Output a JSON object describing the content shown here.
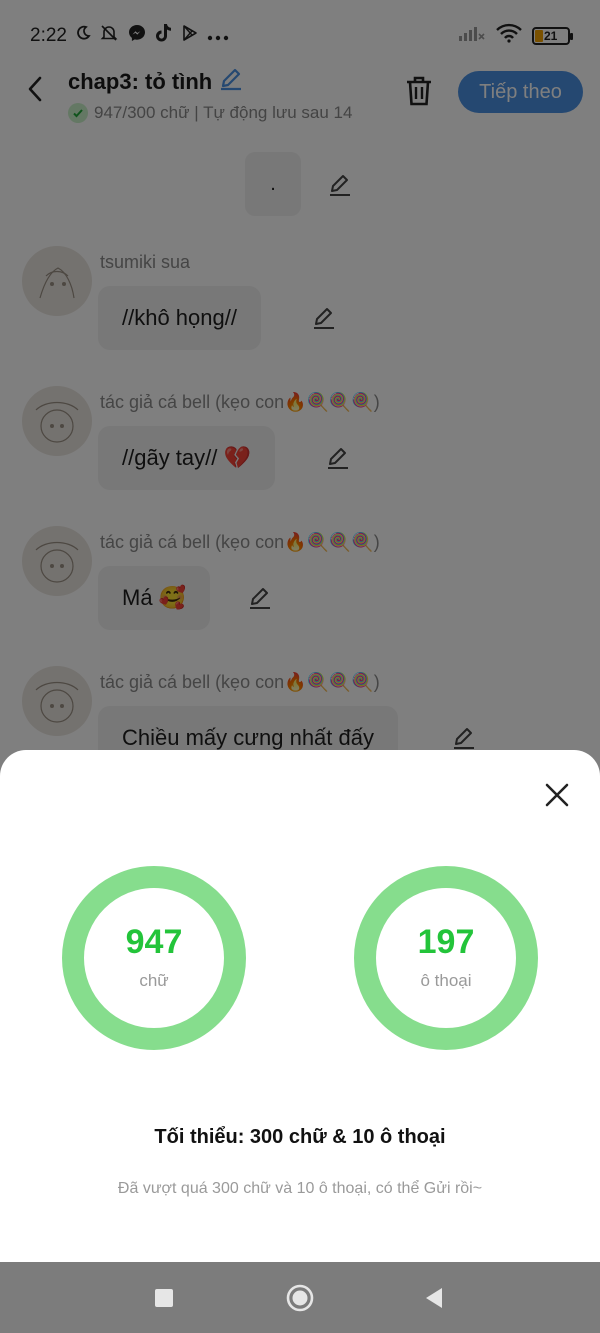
{
  "status_bar": {
    "time": "2:22",
    "battery": "21",
    "left_icons": [
      "moon-icon",
      "muted-bell-icon",
      "messenger-icon",
      "tiktok-icon",
      "play-store-icon",
      "more-dots-icon"
    ],
    "right_icons": [
      "signal-icon",
      "wifi-icon",
      "battery-icon"
    ]
  },
  "header": {
    "title": "chap3: tỏ tình",
    "subtitle": "947/300 chữ | Tự động lưu sau 14",
    "next_label": "Tiếp theo",
    "accent_color": "#4a90e2"
  },
  "chat": {
    "first_bubble": ".",
    "messages": [
      {
        "name": "tsumiki sua",
        "text": "//khô họng//"
      },
      {
        "name": "tác giả cá bell (kẹo con🔥🍭🍭🍭)",
        "text": "//gãy tay// 💔"
      },
      {
        "name": "tác giả cá bell (kẹo con🔥🍭🍭🍭)",
        "text": "Má 🥰"
      },
      {
        "name": "tác giả cá bell (kẹo con🔥🍭🍭🍭)",
        "text": "Chiều mấy cưng nhất đấy"
      }
    ]
  },
  "sheet": {
    "words": {
      "value": "947",
      "label": "chữ"
    },
    "dialogs": {
      "value": "197",
      "label": "ô thoại"
    },
    "minimum": "Tối thiểu: 300 chữ & 10 ô thoại",
    "hint": "Đã vượt quá 300 chữ và 10 ô thoại, có thể Gửi rồi~",
    "ring_color": "#86dd8d",
    "value_color": "#23c43a"
  },
  "nav_bar": {
    "buttons": [
      "recent-apps-icon",
      "home-icon",
      "back-icon"
    ]
  }
}
